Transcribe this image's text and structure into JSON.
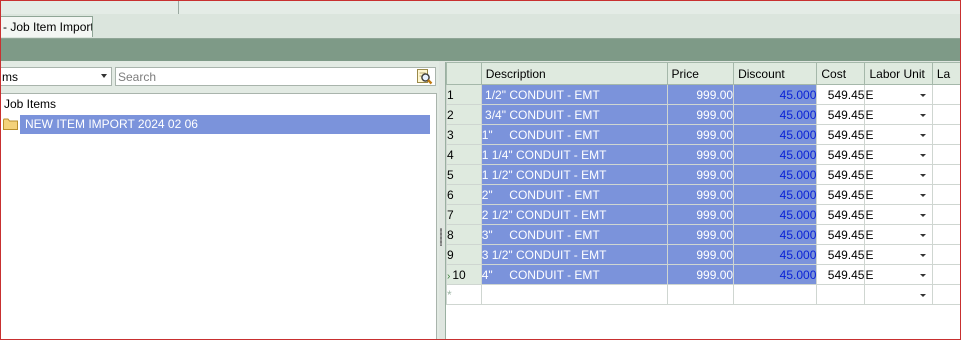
{
  "tab": {
    "label": "- Job Item Import"
  },
  "left": {
    "combo_value": "ms",
    "search_placeholder": "Search",
    "tree_root": "Job Items",
    "tree_child": "NEW ITEM IMPORT 2024 02 06"
  },
  "grid": {
    "headers": {
      "description": "Description",
      "price": "Price",
      "discount": "Discount",
      "cost": "Cost",
      "labor_unit": "Labor Unit",
      "la": "La"
    },
    "rows": [
      {
        "num": "1",
        "description": " 1/2\" CONDUIT - EMT",
        "price": "999.00",
        "discount": "45.000",
        "cost": "549.45",
        "labor_unit": "E"
      },
      {
        "num": "2",
        "description": " 3/4\" CONDUIT - EMT",
        "price": "999.00",
        "discount": "45.000",
        "cost": "549.45",
        "labor_unit": "E"
      },
      {
        "num": "3",
        "description": "1\"     CONDUIT - EMT",
        "price": "999.00",
        "discount": "45.000",
        "cost": "549.45",
        "labor_unit": "E"
      },
      {
        "num": "4",
        "description": "1 1/4\" CONDUIT - EMT",
        "price": "999.00",
        "discount": "45.000",
        "cost": "549.45",
        "labor_unit": "E"
      },
      {
        "num": "5",
        "description": "1 1/2\" CONDUIT - EMT",
        "price": "999.00",
        "discount": "45.000",
        "cost": "549.45",
        "labor_unit": "E"
      },
      {
        "num": "6",
        "description": "2\"     CONDUIT - EMT",
        "price": "999.00",
        "discount": "45.000",
        "cost": "549.45",
        "labor_unit": "E"
      },
      {
        "num": "7",
        "description": "2 1/2\" CONDUIT - EMT",
        "price": "999.00",
        "discount": "45.000",
        "cost": "549.45",
        "labor_unit": "E"
      },
      {
        "num": "8",
        "description": "3\"     CONDUIT - EMT",
        "price": "999.00",
        "discount": "45.000",
        "cost": "549.45",
        "labor_unit": "E"
      },
      {
        "num": "9",
        "description": "3 1/2\" CONDUIT - EMT",
        "price": "999.00",
        "discount": "45.000",
        "cost": "549.45",
        "labor_unit": "E"
      },
      {
        "num": "10",
        "description": "4\"     CONDUIT - EMT",
        "price": "999.00",
        "discount": "45.000",
        "cost": "549.45",
        "labor_unit": "E"
      }
    ],
    "new_row_marker": "*"
  },
  "colors": {
    "selection": "#7b93db",
    "discount_text": "#0a22d6",
    "band": "#7e9a87"
  },
  "icons": {
    "search": "magnifier-doc-icon",
    "folder": "folder-icon",
    "current_row": "row-indicator-arrow-icon",
    "dropdown": "chevron-down-icon"
  }
}
